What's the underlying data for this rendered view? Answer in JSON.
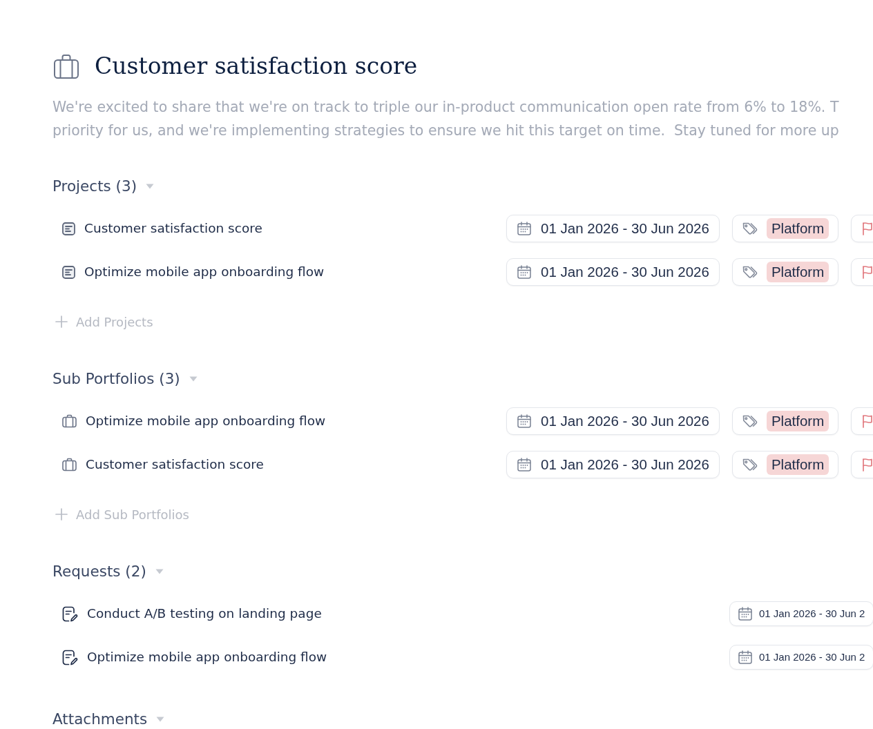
{
  "page": {
    "title": "Customer satisfaction score",
    "description": "We're excited to share that we're on track to triple our in-product communication open rate from 6% to 18%. T\npriority for us, and we're implementing strategies to ensure we hit this target on time.  Stay tuned for more up"
  },
  "sections": [
    {
      "title": "Projects (3)",
      "kind": "projects",
      "expanded": true,
      "items": [
        {
          "name": "Customer satisfaction score",
          "dates": "01 Jan 2026 - 30 Jun 2026",
          "tag": "Platform",
          "flagged": true
        },
        {
          "name": "Optimize mobile app onboarding flow",
          "dates": "01 Jan 2026 - 30 Jun 2026",
          "tag": "Platform",
          "flagged": true
        }
      ],
      "add_label": "Add Projects"
    },
    {
      "title": "Sub Portfolios (3)",
      "kind": "portfolios",
      "expanded": true,
      "items": [
        {
          "name": "Optimize mobile app onboarding flow",
          "dates": "01 Jan 2026 - 30 Jun 2026",
          "tag": "Platform",
          "flagged": true
        },
        {
          "name": "Customer satisfaction score",
          "dates": "01 Jan 2026 - 30 Jun 2026",
          "tag": "Platform",
          "flagged": true
        }
      ],
      "add_label": "Add Sub Portfolios"
    },
    {
      "title": "Requests (2)",
      "kind": "requests",
      "expanded": true,
      "items": [
        {
          "name": "Conduct A/B testing on landing page",
          "dates": "01 Jan 2026 - 30 Jun 2"
        },
        {
          "name": "Optimize mobile app onboarding flow",
          "dates": "01 Jan 2026 - 30 Jun 2"
        }
      ]
    },
    {
      "title": "Attachments",
      "kind": "attachments",
      "expanded": true
    }
  ]
}
